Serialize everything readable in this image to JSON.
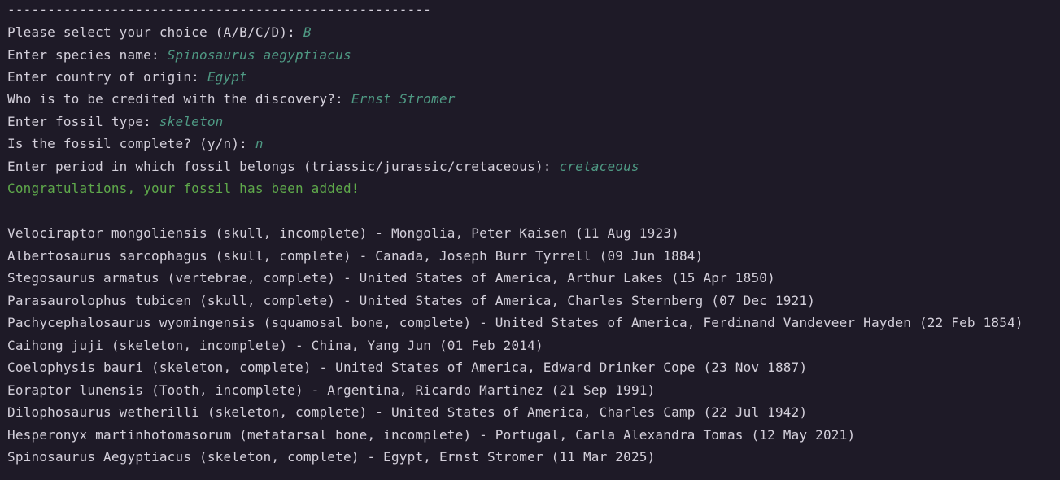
{
  "terminal": {
    "colors": {
      "background": "#1e1a27",
      "text": "#d4d0db",
      "input": "#4f9a84",
      "success": "#5fa94b"
    },
    "separator": "-----------------------------------------------------",
    "prompts": [
      {
        "label": "Please select your choice (A/B/C/D): ",
        "value": "B"
      },
      {
        "label": "Enter species name: ",
        "value": "Spinosaurus aegyptiacus"
      },
      {
        "label": "Enter country of origin: ",
        "value": "Egypt"
      },
      {
        "label": "Who is to be credited with the discovery?: ",
        "value": "Ernst Stromer"
      },
      {
        "label": "Enter fossil type: ",
        "value": "skeleton"
      },
      {
        "label": "Is the fossil complete? (y/n): ",
        "value": "n"
      },
      {
        "label": "Enter period in which fossil belongs (triassic/jurassic/cretaceous): ",
        "value": "cretaceous"
      }
    ],
    "success_message": "Congratulations, your fossil has been added!",
    "fossils": [
      "Velociraptor mongoliensis (skull, incomplete) - Mongolia, Peter Kaisen (11 Aug 1923)",
      "Albertosaurus sarcophagus (skull, complete) - Canada, Joseph Burr Tyrrell (09 Jun 1884)",
      "Stegosaurus armatus (vertebrae, complete) - United States of America, Arthur Lakes (15 Apr 1850)",
      "Parasaurolophus tubicen (skull, complete) - United States of America, Charles Sternberg (07 Dec 1921)",
      "Pachycephalosaurus wyomingensis (squamosal bone, complete) - United States of America, Ferdinand Vandeveer Hayden (22 Feb 1854)",
      "Caihong juji (skeleton, incomplete) - China, Yang Jun (01 Feb 2014)",
      "Coelophysis bauri (skeleton, complete) - United States of America, Edward Drinker Cope (23 Nov 1887)",
      "Eoraptor lunensis (Tooth, incomplete) - Argentina, Ricardo Martinez (21 Sep 1991)",
      "Dilophosaurus wetherilli (skeleton, complete) - United States of America, Charles Camp (22 Jul 1942)",
      "Hesperonyx martinhotomasorum (metatarsal bone, incomplete) - Portugal, Carla Alexandra Tomas (12 May 2021)",
      "Spinosaurus Aegyptiacus (skeleton, complete) - Egypt, Ernst Stromer (11 Mar 2025)"
    ]
  }
}
